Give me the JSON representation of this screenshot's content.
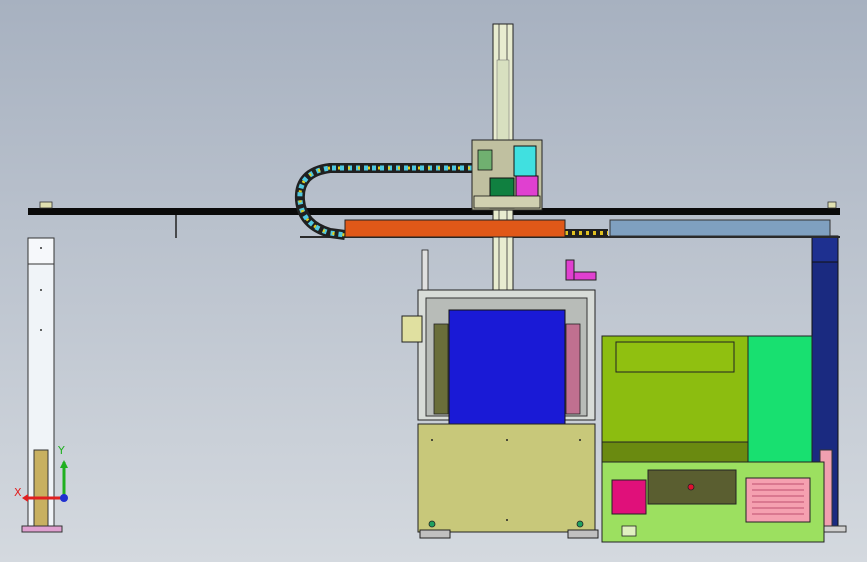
{
  "viewport": {
    "background_top": "#a7b1c0",
    "background_bottom": "#d4d9df"
  },
  "triad": {
    "x_label": "X",
    "y_label": "Y",
    "x_color": "#e02020",
    "y_color": "#20b020",
    "z_color": "#2030d0"
  },
  "colors": {
    "beam": "#0a0a0a",
    "carriage": "#e05818",
    "slide_cover": "#7fa0c0",
    "cabinet_base": "#c8c87a",
    "sheet": "#1a1ad6",
    "console_green": "#8cbd10",
    "console_light_green": "#18e070",
    "door_panel": "#5a5e30",
    "pink_panel": "#e0107a",
    "vent_panel": "#f5a0b0",
    "right_column": "#1a2a80",
    "left_column": "#f0f4f8"
  }
}
